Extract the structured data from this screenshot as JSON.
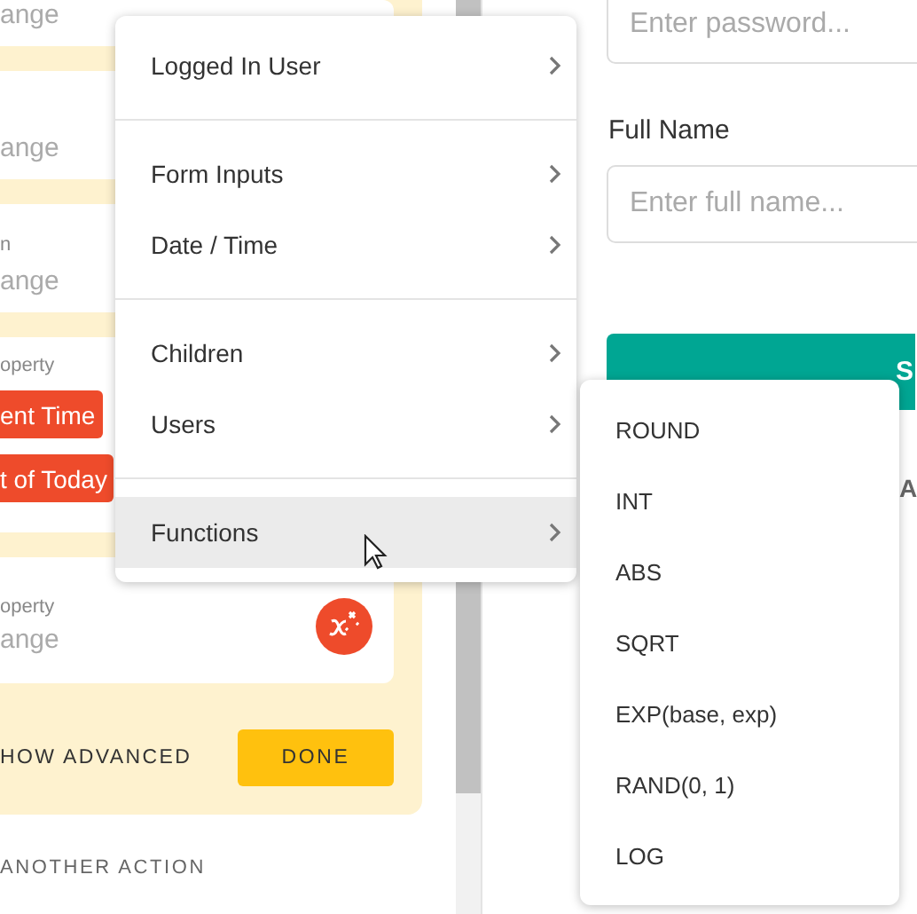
{
  "left_panel": {
    "cards": [
      {
        "kind": "field",
        "value": "ange"
      },
      {
        "kind": "field",
        "value": "ange"
      },
      {
        "kind": "field",
        "label": "n",
        "value": "ange"
      },
      {
        "kind": "buttons",
        "label": "operty",
        "buttons": [
          "ent Time",
          "t of Today"
        ]
      },
      {
        "kind": "formula",
        "label": "operty",
        "value": "ange"
      }
    ],
    "show_advanced": "HOW ADVANCED",
    "done_button": "DONE",
    "add_action": "ANOTHER ACTION"
  },
  "form": {
    "password_field": {
      "placeholder": "Enter password..."
    },
    "full_name_label": "Full Name",
    "full_name_field": {
      "placeholder": "Enter full name..."
    },
    "submit_button": "S",
    "heading": "A"
  },
  "context_menu": {
    "groups": [
      {
        "items": [
          {
            "label": "Logged In User",
            "selected": false,
            "has_submenu": true
          }
        ]
      },
      {
        "items": [
          {
            "label": "Form Inputs",
            "selected": false,
            "has_submenu": true
          },
          {
            "label": "Date / Time",
            "selected": false,
            "has_submenu": true
          }
        ]
      },
      {
        "items": [
          {
            "label": "Children",
            "selected": false,
            "has_submenu": true
          },
          {
            "label": "Users",
            "selected": false,
            "has_submenu": true
          }
        ]
      },
      {
        "items": [
          {
            "label": "Functions",
            "selected": true,
            "has_submenu": true
          }
        ]
      }
    ]
  },
  "submenu": {
    "items": [
      {
        "label": "ROUND"
      },
      {
        "label": "INT"
      },
      {
        "label": "ABS"
      },
      {
        "label": "SQRT"
      },
      {
        "label": "EXP(base, exp)"
      },
      {
        "label": "RAND(0, 1)"
      },
      {
        "label": "LOG"
      }
    ]
  }
}
